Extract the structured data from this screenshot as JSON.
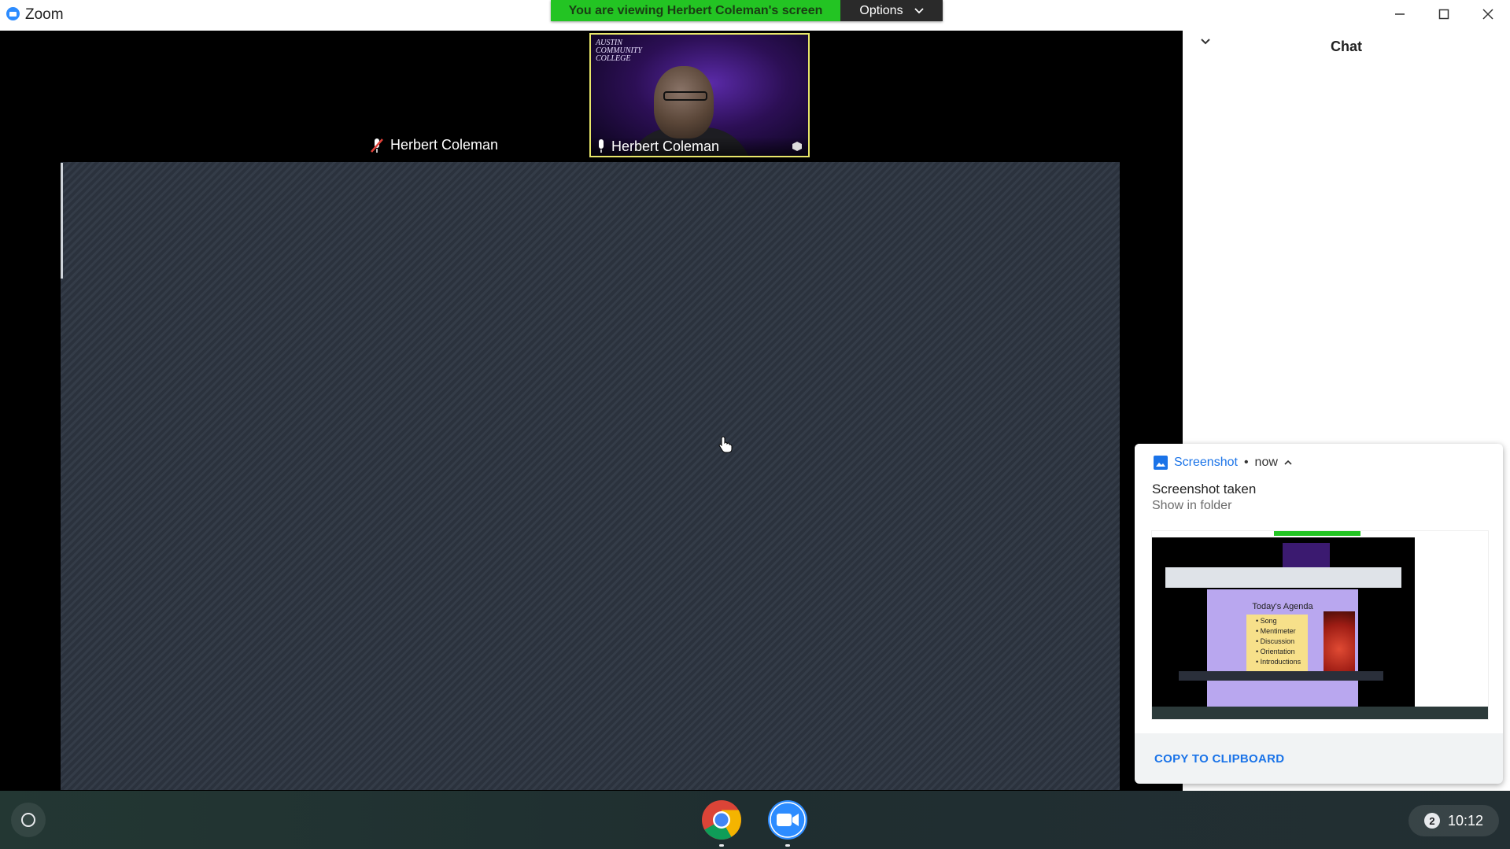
{
  "window": {
    "app_title": "Zoom",
    "banner_text": "You are viewing Herbert Coleman's screen",
    "options_label": "Options"
  },
  "video": {
    "participant_name": "Herbert Coleman",
    "logo_line1": "AUSTIN",
    "logo_line2": "COMMUNITY",
    "logo_line3": "COLLEGE"
  },
  "speaker": {
    "name": "Herbert Coleman",
    "muted": true
  },
  "chat": {
    "title": "Chat"
  },
  "notification": {
    "app": "Screenshot",
    "separator": "•",
    "time": "now",
    "title": "Screenshot taken",
    "subtitle": "Show in folder",
    "action": "COPY TO CLIPBOARD",
    "thumbnail": {
      "slide_title": "Today's Agenda",
      "items": [
        "Song",
        "Mentimeter",
        "Discussion",
        "Orientation",
        "Introductions"
      ]
    }
  },
  "shelf": {
    "notification_count": "2",
    "time": "10:12"
  },
  "colors": {
    "banner_green": "#23c423",
    "accent_blue": "#1a73e8",
    "shared_screen": "#2f3641"
  }
}
